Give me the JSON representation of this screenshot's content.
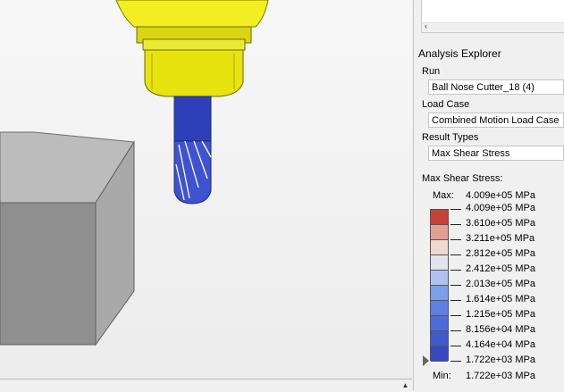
{
  "explorer": {
    "title": "Analysis Explorer",
    "run": {
      "label": "Run",
      "value": "Ball Nose Cutter_18 (4)"
    },
    "load_case": {
      "label": "Load Case",
      "value": "Combined Motion Load Case"
    },
    "result_types": {
      "label": "Result Types",
      "value": "Max Shear Stress"
    }
  },
  "legend": {
    "title": "Max Shear Stress:",
    "max_label": "Max:",
    "max_value": "4.009e+05 MPa",
    "min_label": "Min:",
    "min_value": "1.722e+03 MPa",
    "ticks": [
      "4.009e+05 MPa",
      "3.610e+05 MPa",
      "3.211e+05 MPa",
      "2.812e+05 MPa",
      "2.412e+05 MPa",
      "2.013e+05 MPa",
      "1.614e+05 MPa",
      "1.215e+05 MPa",
      "8.156e+04 MPa",
      "4.164e+04 MPa",
      "1.722e+03 MPa"
    ],
    "colors": [
      "#c8403a",
      "#e2a093",
      "#ecd9cf",
      "#dfe4ef",
      "#aec2ee",
      "#7f9ee8",
      "#5f80e0",
      "#4d6cd8",
      "#4259cc",
      "#3848c0"
    ]
  },
  "icons": {
    "tree_scroll_left": "‹",
    "viewport_scroll_up": "▲"
  }
}
